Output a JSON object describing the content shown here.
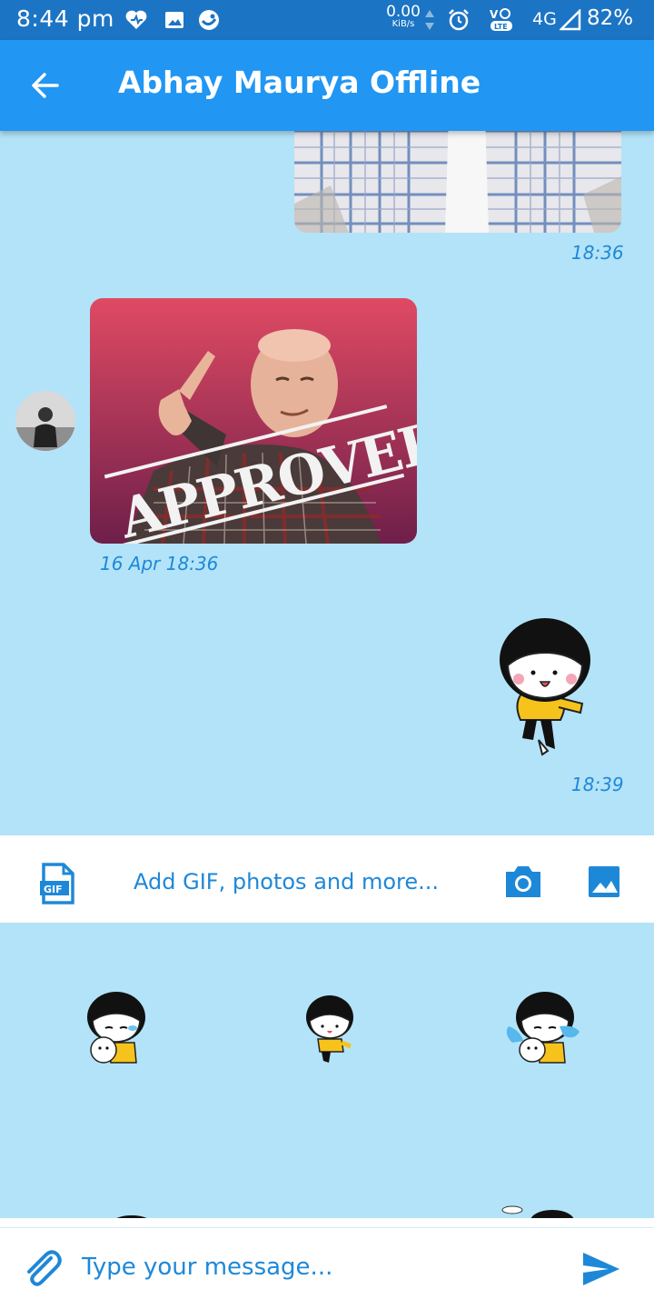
{
  "status_bar": {
    "time": "8:44 pm",
    "net_speed_value": "0.00",
    "net_speed_unit": "KiB/s",
    "network": "4G",
    "battery": "82%",
    "icons": [
      "heart-icon",
      "gallery-notification-icon",
      "app-notification-icon",
      "alarm-icon",
      "volte-icon",
      "signal-icon"
    ]
  },
  "app_bar": {
    "title": "Abhay Maurya Offline",
    "back_icon": "arrow-left-icon"
  },
  "chat": {
    "messages": [
      {
        "type": "image",
        "sender": "me",
        "description": "photo",
        "timestamp": "18:36"
      },
      {
        "type": "image",
        "sender": "them",
        "description": "approved meme gif",
        "timestamp": "16 Apr 18:36"
      },
      {
        "type": "sticker",
        "sender": "me",
        "timestamp": "18:39"
      }
    ]
  },
  "attach_bar": {
    "label": "Add GIF, photos and more...",
    "icons": [
      "gif-icon",
      "camera-icon",
      "image-icon"
    ]
  },
  "composer": {
    "placeholder": "Type your message...",
    "icons": [
      "paperclip-icon",
      "send-icon"
    ]
  },
  "colors": {
    "status_bar": "#1c74c4",
    "app_bar": "#2196f3",
    "chat_bg": "#b3e3f8",
    "accent": "#1e88d8"
  }
}
